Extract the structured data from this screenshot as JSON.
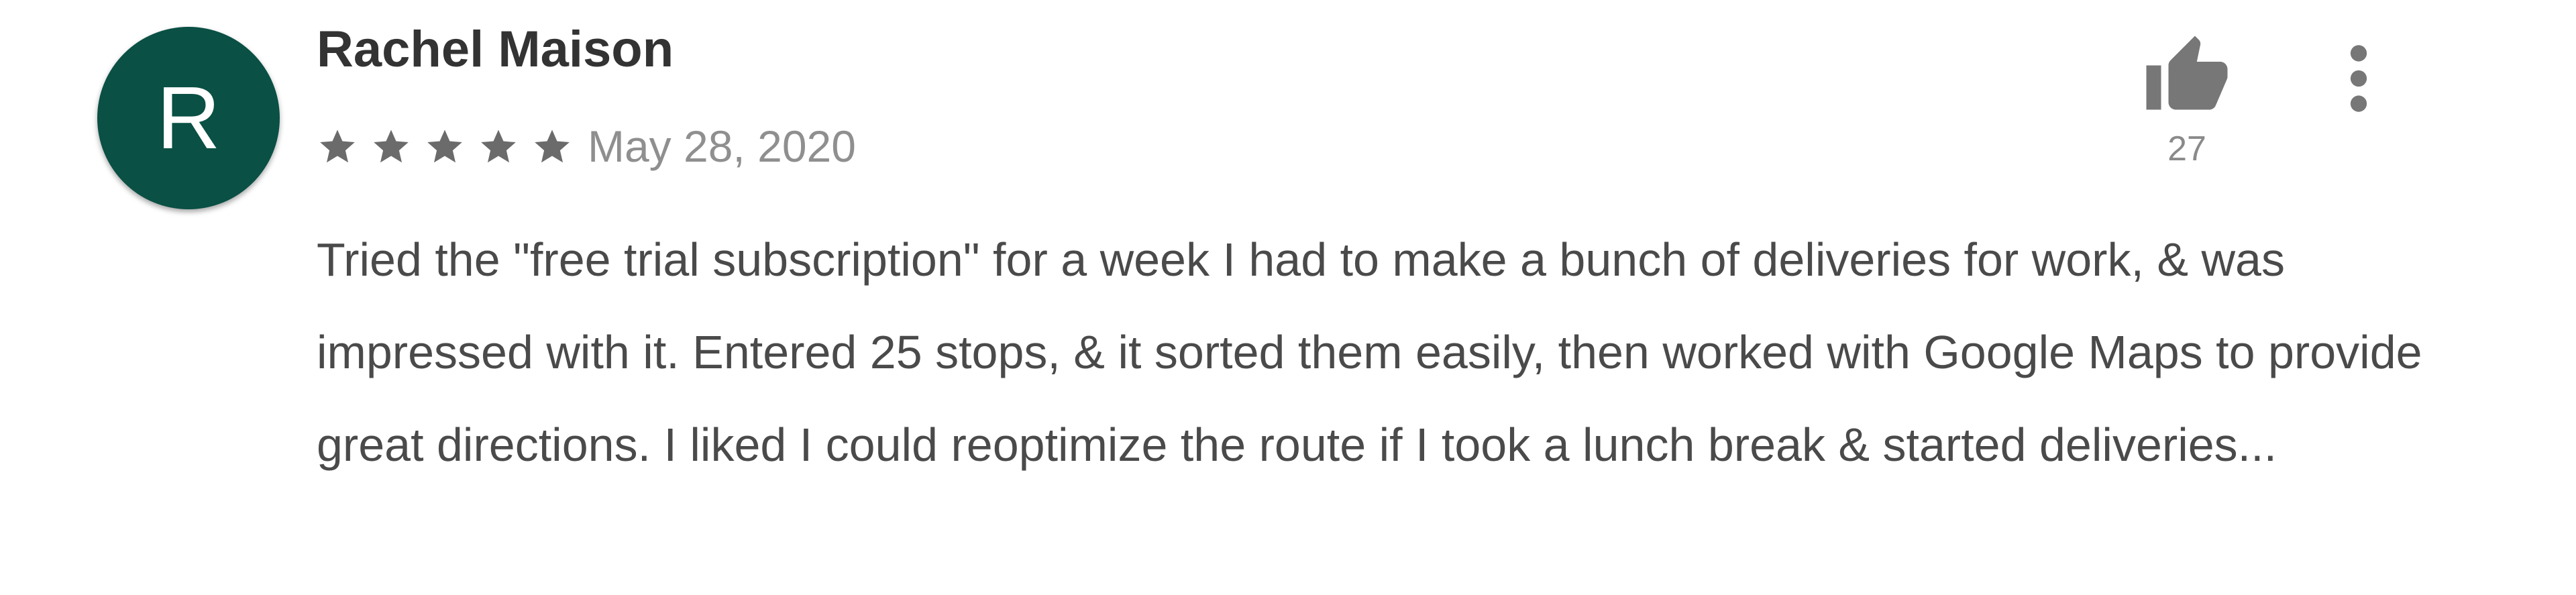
{
  "review": {
    "avatar_letter": "R",
    "reviewer_name": "Rachel Maison",
    "rating": 5,
    "rating_max": 5,
    "date": "May 28, 2020",
    "text": "Tried the \"free trial subscription\" for a week I had to make a bunch of deliveries for work, & was impressed with it. Entered 25 stops, & it sorted them easily, then worked with Google Maps to provide great directions. I liked I could reoptimize the route if I took a lunch break & started deliveries...",
    "helpful_count": "27"
  },
  "icons": {
    "thumb": "thumbs-up-icon",
    "more": "more-vert-icon",
    "star": "star-icon"
  },
  "colors": {
    "avatar_bg": "#0a5044",
    "star": "#6b6b6b",
    "icon": "#777777",
    "name": "#333333",
    "body_text": "#4a4a4a",
    "muted": "#8f8f8f"
  }
}
